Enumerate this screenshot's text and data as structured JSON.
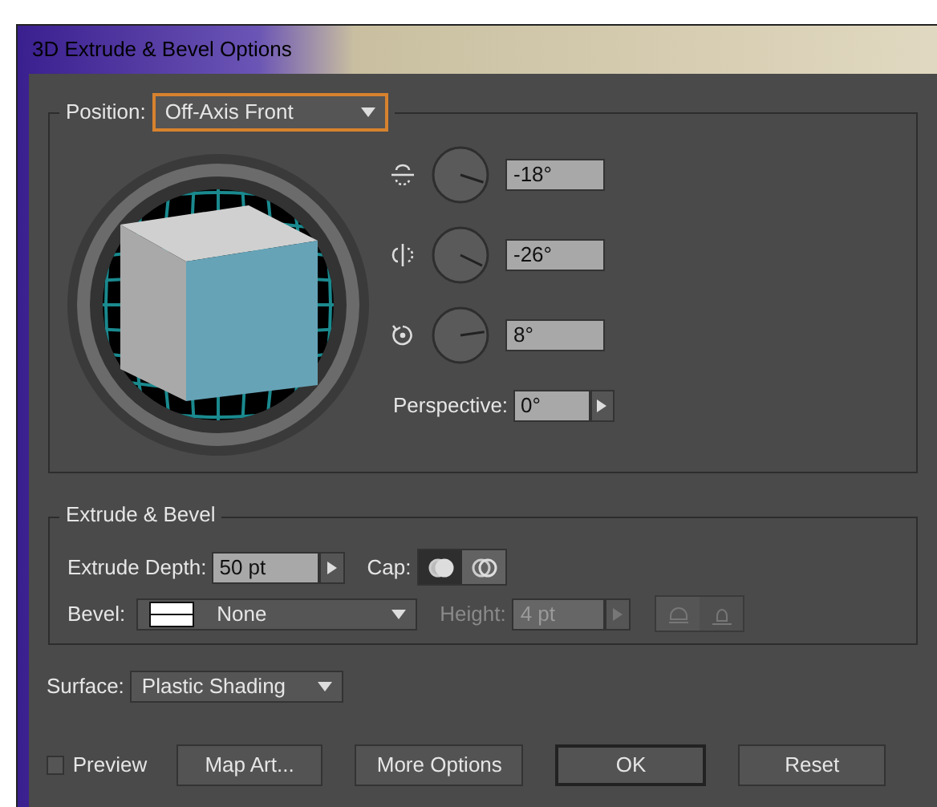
{
  "window": {
    "title": "3D Extrude & Bevel Options"
  },
  "position": {
    "label": "Position:",
    "value": "Off-Axis Front",
    "focused": true,
    "rotations": [
      {
        "kind": "x",
        "value": "-18°"
      },
      {
        "kind": "y",
        "value": "-26°"
      },
      {
        "kind": "z",
        "value": "8°"
      }
    ],
    "perspective": {
      "label": "Perspective:",
      "value": "0°"
    }
  },
  "extrude_bevel": {
    "title": "Extrude & Bevel",
    "depth": {
      "label": "Extrude Depth:",
      "value": "50 pt"
    },
    "cap_label": "Cap:",
    "caps": [
      {
        "kind": "on",
        "selected": true
      },
      {
        "kind": "off",
        "selected": false
      }
    ],
    "bevel": {
      "label": "Bevel:",
      "value": "None"
    },
    "height": {
      "label": "Height:",
      "value": "4 pt",
      "disabled": true
    }
  },
  "surface": {
    "label": "Surface:",
    "value": "Plastic Shading"
  },
  "preview": {
    "label": "Preview",
    "checked": false
  },
  "buttons": [
    {
      "label": "Map Art...",
      "default": false
    },
    {
      "label": "More Options",
      "default": false
    },
    {
      "label": "OK",
      "default": true
    },
    {
      "label": "Reset",
      "default": false
    }
  ]
}
